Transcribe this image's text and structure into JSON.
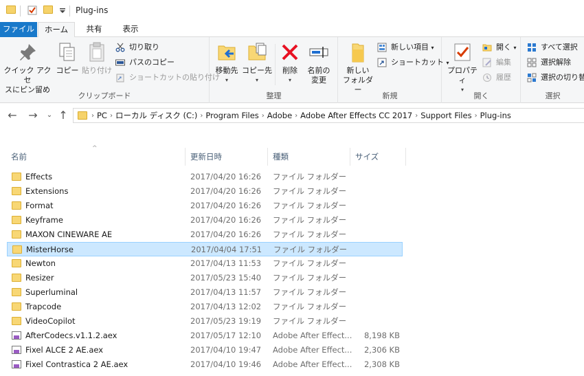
{
  "window": {
    "title": "Plug-ins"
  },
  "tabs": {
    "file": "ファイル",
    "home": "ホーム",
    "share": "共有",
    "view": "表示"
  },
  "ribbon": {
    "clipboard": {
      "pin": "クイック アクセ\nスにピン留め",
      "copy": "コピー",
      "paste": "貼り付け",
      "cut": "切り取り",
      "copy_path": "パスのコピー",
      "paste_shortcut": "ショートカットの貼り付け",
      "label": "クリップボード"
    },
    "organize": {
      "move_to": "移動先",
      "copy_to": "コピー先",
      "delete": "削除",
      "rename": "名前の\n変更",
      "label": "整理"
    },
    "new": {
      "new_folder": "新しい\nフォルダー",
      "new_item": "新しい項目",
      "shortcut": "ショートカット",
      "label": "新規"
    },
    "open": {
      "properties": "プロパティ",
      "open": "開く",
      "edit": "編集",
      "history": "履歴",
      "label": "開く"
    },
    "select": {
      "select_all": "すべて選択",
      "select_none": "選択解除",
      "invert": "選択の切り替え",
      "label": "選択"
    }
  },
  "address": {
    "crumbs": [
      "PC",
      "ローカル ディスク (C:)",
      "Program Files",
      "Adobe",
      "Adobe After Effects CC 2017",
      "Support Files",
      "Plug-ins"
    ]
  },
  "columns": {
    "name": "名前",
    "date": "更新日時",
    "type": "種類",
    "size": "サイズ"
  },
  "files": [
    {
      "name": "Effects",
      "date": "2017/04/20 16:26",
      "type": "ファイル フォルダー",
      "size": "",
      "kind": "folder"
    },
    {
      "name": "Extensions",
      "date": "2017/04/20 16:26",
      "type": "ファイル フォルダー",
      "size": "",
      "kind": "folder"
    },
    {
      "name": "Format",
      "date": "2017/04/20 16:26",
      "type": "ファイル フォルダー",
      "size": "",
      "kind": "folder"
    },
    {
      "name": "Keyframe",
      "date": "2017/04/20 16:26",
      "type": "ファイル フォルダー",
      "size": "",
      "kind": "folder"
    },
    {
      "name": "MAXON CINEWARE AE",
      "date": "2017/04/20 16:26",
      "type": "ファイル フォルダー",
      "size": "",
      "kind": "folder"
    },
    {
      "name": "MisterHorse",
      "date": "2017/04/04 17:51",
      "type": "ファイル フォルダー",
      "size": "",
      "kind": "folder",
      "selected": true
    },
    {
      "name": "Newton",
      "date": "2017/04/13 11:53",
      "type": "ファイル フォルダー",
      "size": "",
      "kind": "folder"
    },
    {
      "name": "Resizer",
      "date": "2017/05/23 15:40",
      "type": "ファイル フォルダー",
      "size": "",
      "kind": "folder"
    },
    {
      "name": "Superluminal",
      "date": "2017/04/13 11:57",
      "type": "ファイル フォルダー",
      "size": "",
      "kind": "folder"
    },
    {
      "name": "Trapcode",
      "date": "2017/04/13 12:02",
      "type": "ファイル フォルダー",
      "size": "",
      "kind": "folder"
    },
    {
      "name": "VideoCopilot",
      "date": "2017/05/23 19:19",
      "type": "ファイル フォルダー",
      "size": "",
      "kind": "folder"
    },
    {
      "name": "AfterCodecs.v1.1.2.aex",
      "date": "2017/05/17 12:10",
      "type": "Adobe After Effect...",
      "size": "8,198 KB",
      "kind": "file"
    },
    {
      "name": "Fixel ALCE 2 AE.aex",
      "date": "2017/04/10 19:47",
      "type": "Adobe After Effect...",
      "size": "2,306 KB",
      "kind": "file"
    },
    {
      "name": "Fixel Contrastica 2 AE.aex",
      "date": "2017/04/10 19:46",
      "type": "Adobe After Effect...",
      "size": "2,308 KB",
      "kind": "file"
    }
  ]
}
